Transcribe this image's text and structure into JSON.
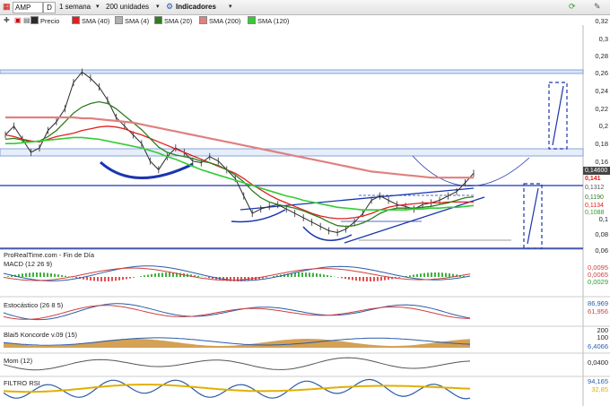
{
  "toolbar": {
    "symbol": "AMP",
    "period_button": "D",
    "timeframe": "1 semana",
    "units": "200 unidades",
    "indicators": "Indicadores"
  },
  "legend": [
    {
      "label": "Precio",
      "color": "#2b2b2b"
    },
    {
      "label": "SMA (40)",
      "color": "#e02020"
    },
    {
      "label": "SMA (4)",
      "color": "#b0b0b0"
    },
    {
      "label": "SMA (20)",
      "color": "#2e7d1e"
    },
    {
      "label": "SMA (200)",
      "color": "#e08080"
    },
    {
      "label": "SMA (120)",
      "color": "#33cc33"
    }
  ],
  "footer": "ProRealTime.com - Fin de Día",
  "panels": {
    "macd": "MACD (12 26 9)",
    "stoch": "Estocástico (26 8 5)",
    "koncorde": "Blai5 Koncorde v.09 (15)",
    "mom": "Mom (12)",
    "rsi": "FILTRO RSI"
  },
  "chart_data": {
    "type": "line",
    "price_axis": {
      "ylim": [
        0.06,
        0.32
      ],
      "ticks": [
        "0,32",
        "0,3",
        "0,28",
        "0,26",
        "0,24",
        "0,22",
        "0,2",
        "0,18",
        "0,16",
        "0,14",
        "0,12",
        "0,1",
        "0,08",
        "0,06"
      ]
    },
    "price_tags": [
      {
        "text": "0,14600",
        "color": "#ffffff",
        "bg": "#444444"
      },
      {
        "text": "0,141",
        "color": "#e02020",
        "bg": "#ffffff"
      },
      {
        "text": "0,1312",
        "color": "#555555",
        "bg": "#ffffff"
      },
      {
        "text": "0,1190",
        "color": "#2e7d1e",
        "bg": "#ffffff"
      },
      {
        "text": "0,1134",
        "color": "#e02020",
        "bg": "#ffffff"
      },
      {
        "text": "0,1088",
        "color": "#33cc33",
        "bg": "#ffffff"
      },
      {
        "text": "0,1",
        "color": "#222222",
        "bg": "#ffffff"
      }
    ],
    "series": [
      {
        "name": "Precio",
        "values": [
          0.19,
          0.2,
          0.185,
          0.17,
          0.175,
          0.195,
          0.205,
          0.22,
          0.25,
          0.262,
          0.255,
          0.245,
          0.23,
          0.21,
          0.2,
          0.19,
          0.18,
          0.16,
          0.15,
          0.165,
          0.175,
          0.17,
          0.16,
          0.158,
          0.165,
          0.16,
          0.15,
          0.14,
          0.12,
          0.1,
          0.105,
          0.108,
          0.11,
          0.105,
          0.1,
          0.095,
          0.09,
          0.085,
          0.08,
          0.078,
          0.082,
          0.09,
          0.1,
          0.115,
          0.12,
          0.115,
          0.11,
          0.108,
          0.105,
          0.11,
          0.112,
          0.115,
          0.12,
          0.125,
          0.135,
          0.146
        ]
      },
      {
        "name": "SMA (40)",
        "values": [
          0.19,
          0.188,
          0.185,
          0.183,
          0.182,
          0.185,
          0.188,
          0.19,
          0.192,
          0.195,
          0.197,
          0.199,
          0.2,
          0.199,
          0.197,
          0.193,
          0.19,
          0.186,
          0.182,
          0.178,
          0.174,
          0.17,
          0.166,
          0.162,
          0.158,
          0.154,
          0.15,
          0.146,
          0.14,
          0.133,
          0.127,
          0.121,
          0.116,
          0.112,
          0.108,
          0.104,
          0.1,
          0.097,
          0.095,
          0.094,
          0.094,
          0.095,
          0.097,
          0.1,
          0.104,
          0.107,
          0.109,
          0.11,
          0.111,
          0.112,
          0.112,
          0.112,
          0.113,
          0.113,
          0.113,
          0.113
        ]
      },
      {
        "name": "SMA (20)",
        "values": [
          0.185,
          0.186,
          0.184,
          0.182,
          0.183,
          0.188,
          0.195,
          0.205,
          0.215,
          0.222,
          0.226,
          0.228,
          0.226,
          0.22,
          0.212,
          0.204,
          0.196,
          0.186,
          0.176,
          0.17,
          0.167,
          0.165,
          0.163,
          0.16,
          0.158,
          0.155,
          0.15,
          0.144,
          0.136,
          0.126,
          0.118,
          0.113,
          0.11,
          0.108,
          0.106,
          0.103,
          0.099,
          0.095,
          0.09,
          0.086,
          0.085,
          0.086,
          0.089,
          0.094,
          0.1,
          0.104,
          0.106,
          0.106,
          0.106,
          0.107,
          0.108,
          0.11,
          0.112,
          0.115,
          0.118,
          0.119
        ]
      },
      {
        "name": "SMA (200)",
        "values": [
          0.21,
          0.21,
          0.21,
          0.21,
          0.21,
          0.21,
          0.21,
          0.21,
          0.21,
          0.209,
          0.209,
          0.208,
          0.207,
          0.206,
          0.205,
          0.204,
          0.202,
          0.2,
          0.198,
          0.196,
          0.194,
          0.192,
          0.19,
          0.188,
          0.186,
          0.184,
          0.182,
          0.18,
          0.178,
          0.176,
          0.174,
          0.172,
          0.17,
          0.168,
          0.166,
          0.164,
          0.162,
          0.16,
          0.158,
          0.156,
          0.154,
          0.152,
          0.15,
          0.148,
          0.147,
          0.146,
          0.145,
          0.144,
          0.143,
          0.142,
          0.141,
          0.141,
          0.141,
          0.141,
          0.141,
          0.141
        ]
      },
      {
        "name": "SMA (120)",
        "values": [
          0.18,
          0.18,
          0.181,
          0.182,
          0.183,
          0.184,
          0.185,
          0.186,
          0.187,
          0.187,
          0.186,
          0.185,
          0.183,
          0.181,
          0.179,
          0.177,
          0.175,
          0.172,
          0.169,
          0.165,
          0.162,
          0.158,
          0.154,
          0.15,
          0.147,
          0.144,
          0.141,
          0.138,
          0.135,
          0.132,
          0.129,
          0.126,
          0.123,
          0.12,
          0.118,
          0.115,
          0.113,
          0.111,
          0.109,
          0.107,
          0.106,
          0.105,
          0.104,
          0.104,
          0.104,
          0.104,
          0.104,
          0.104,
          0.105,
          0.105,
          0.106,
          0.106,
          0.107,
          0.107,
          0.108,
          0.109
        ]
      }
    ],
    "macd_tags": [
      "0,0095",
      "0,0065",
      "0,0029"
    ],
    "stoch_tags": [
      "86,969",
      "61,956"
    ],
    "koncorde_ticks": [
      "200",
      "100"
    ],
    "koncorde_tags": [
      "6,4066"
    ],
    "mom_tags": [
      "0,0400"
    ],
    "rsi_tags": [
      "94,165",
      "32,85"
    ]
  }
}
